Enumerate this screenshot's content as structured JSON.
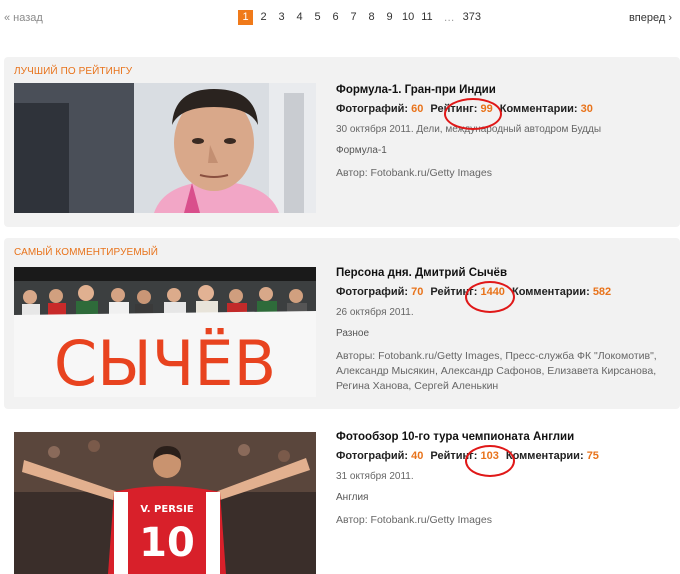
{
  "pager": {
    "prev": "« назад",
    "next": "вперед ›",
    "pages": [
      "1",
      "2",
      "3",
      "4",
      "5",
      "6",
      "7",
      "8",
      "9",
      "10",
      "11"
    ],
    "current": "1",
    "ellipsis": "…",
    "last": "373"
  },
  "cards": [
    {
      "label": "ЛУЧШИЙ ПО РЕЙТИНГУ",
      "title": "Формула-1. Гран-при Индии",
      "photos_label": "Фотографий:",
      "photos": "60",
      "rating_label": "Рейтинг:",
      "rating": "99",
      "comments_label": "Комментарии:",
      "comments": "30",
      "date": "30 октября 2011. Дели, международный автодром Будды",
      "category": "Формула-1",
      "author": "Автор: Fotobank.ru/Getty Images"
    },
    {
      "label": "САМЫЙ КОММЕНТИРУЕМЫЙ",
      "title": "Персона дня. Дмитрий Сычёв",
      "photos_label": "Фотографий:",
      "photos": "70",
      "rating_label": "Рейтинг:",
      "rating": "1440",
      "comments_label": "Комментарии:",
      "comments": "582",
      "date": "26 октября 2011.",
      "category": "Разное",
      "author": "Авторы: Fotobank.ru/Getty Images, Пресс-служба ФК \"Локомотив\", Александр Мысякин, Александр Сафонов, Елизавета Кирсанова, Регина Ханова, Сергей Аленькин",
      "banner_text": "СЫЧЁВ"
    },
    {
      "label": "",
      "title": "Фотообзор 10-го тура чемпионата Англии",
      "photos_label": "Фотографий:",
      "photos": "40",
      "rating_label": "Рейтинг:",
      "rating": "103",
      "comments_label": "Комментарии:",
      "comments": "75",
      "date": "31 октября 2011.",
      "category": "Англия",
      "author": "Автор: Fotobank.ru/Getty Images",
      "shirt_name": "V. PERSIE",
      "shirt_number": "10"
    }
  ]
}
